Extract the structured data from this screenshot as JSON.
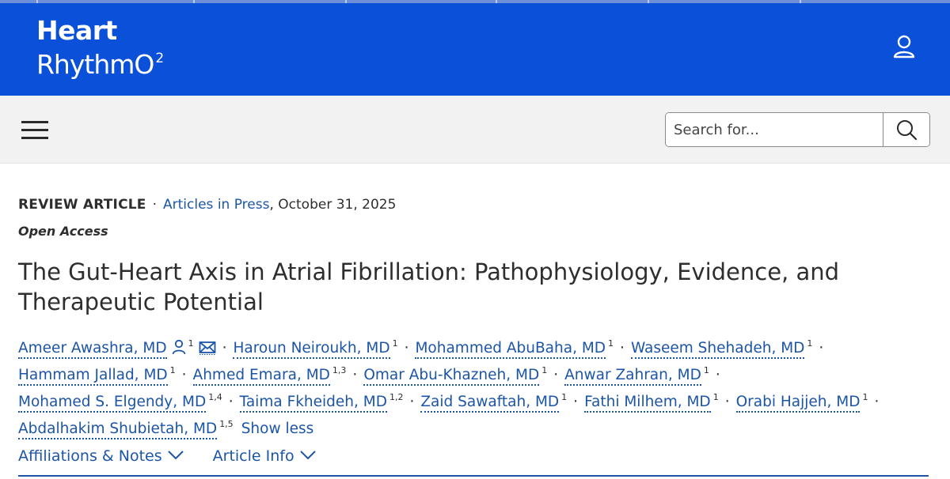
{
  "brand": {
    "logo_line1": "Heart",
    "logo_line2": "RhythmO",
    "logo_sup": "2"
  },
  "search": {
    "placeholder": "Search for..."
  },
  "article": {
    "type": "REVIEW ARTICLE",
    "journal_section": "Articles in Press",
    "date": ", October 31, 2025",
    "access": "Open Access",
    "title": "The Gut-Heart Axis in Atrial Fibrillation: Pathophysiology, Evidence, and Therapeutic Potential"
  },
  "authors": [
    {
      "name": "Ameer Awashra, MD",
      "aff": "1"
    },
    {
      "name": "Haroun Neiroukh, MD",
      "aff": "1"
    },
    {
      "name": "Mohammed AbuBaha, MD",
      "aff": "1"
    },
    {
      "name": "Waseem Shehadeh, MD",
      "aff": "1"
    },
    {
      "name": "Hammam Jallad, MD",
      "aff": "1"
    },
    {
      "name": "Ahmed Emara, MD",
      "aff": "1,3"
    },
    {
      "name": "Omar Abu-Khazneh, MD",
      "aff": "1"
    },
    {
      "name": "Anwar Zahran, MD",
      "aff": "1"
    },
    {
      "name": "Mohamed S. Elgendy, MD",
      "aff": "1,4"
    },
    {
      "name": "Taima Fkheideh, MD",
      "aff": "1,2"
    },
    {
      "name": "Zaid Sawaftah, MD",
      "aff": "1"
    },
    {
      "name": "Fathi Milhem, MD",
      "aff": "1"
    },
    {
      "name": "Orabi Hajjeh, MD",
      "aff": "1"
    },
    {
      "name": "Abdalhakim Shubietah, MD",
      "aff": "1,5"
    }
  ],
  "show_less_label": "Show less",
  "tabs": [
    {
      "label": "Affiliations & Notes"
    },
    {
      "label": "Article Info"
    }
  ],
  "colors": {
    "brand_blue": "#0a50d8",
    "link_blue": "#1c55a8",
    "nav_gray": "#f2f2f2"
  },
  "icons": {
    "user": "user-icon",
    "search": "search-icon",
    "menu": "hamburger-menu-icon",
    "author_profile": "person-icon",
    "email": "envelope-icon",
    "chevron": "chevron-down-icon"
  }
}
